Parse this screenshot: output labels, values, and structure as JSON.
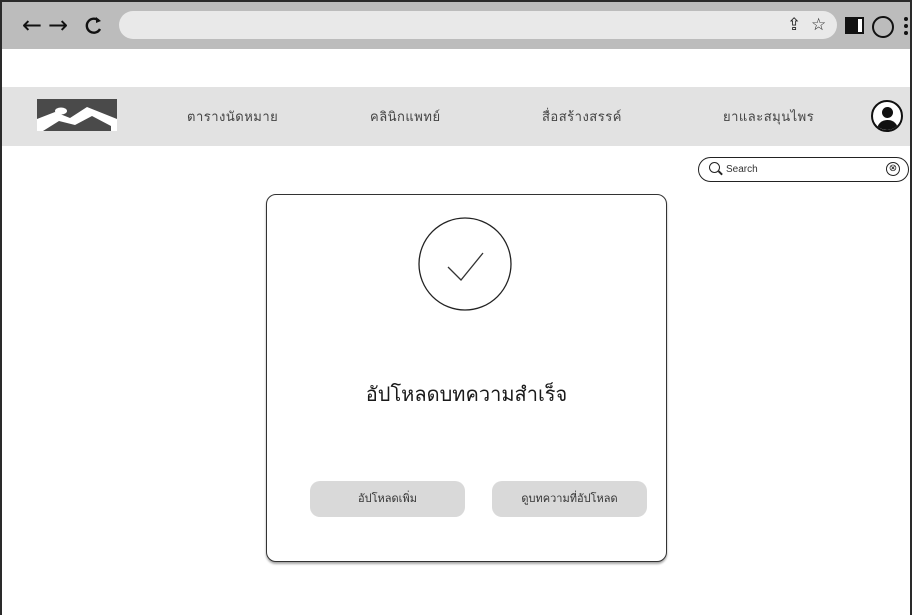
{
  "browser": {
    "back_label": "←",
    "forward_label": "→",
    "reload_label": "C",
    "share_icon": "⇪",
    "star_icon": "☆"
  },
  "nav": {
    "items": [
      {
        "label": "ตารางนัดหมาย"
      },
      {
        "label": "คลินิกแพทย์"
      },
      {
        "label": "สื่อสร้างสรรค์"
      },
      {
        "label": "ยาและสมุนไพร"
      }
    ]
  },
  "search": {
    "placeholder": "Search",
    "clear_icon": "⊗"
  },
  "dialog": {
    "title": "อัปโหลดบทความสำเร็จ",
    "upload_more_label": "อัปโหลดเพิ่ม",
    "view_uploaded_label": "ดูบทความที่อัปโหลด"
  },
  "colors": {
    "chrome_bar": "#bcbcbc",
    "header_bg": "#e2e2e2",
    "button_bg": "#d9d9d9"
  }
}
